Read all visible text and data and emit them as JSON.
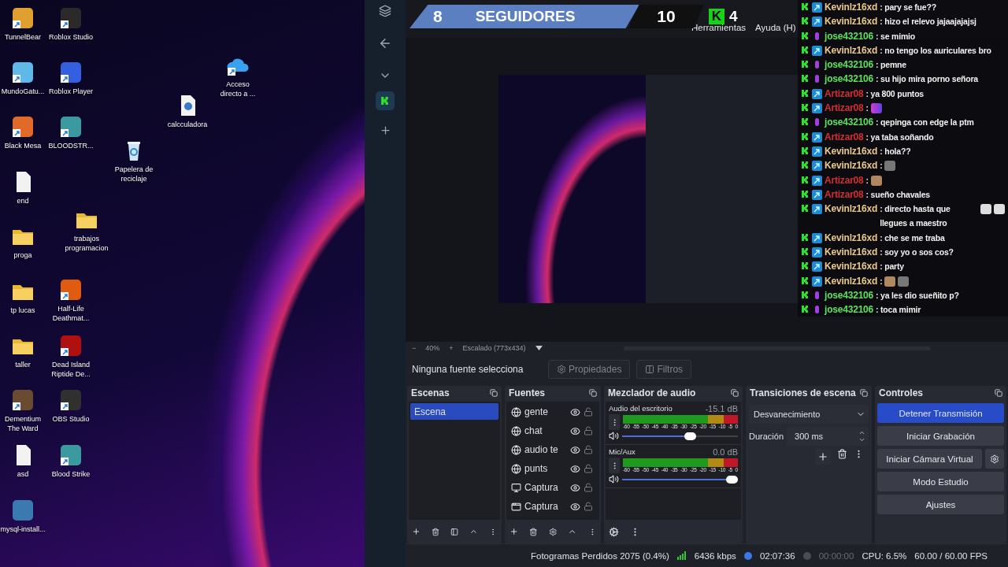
{
  "desktop": {
    "icons": [
      {
        "label": "TunnelBear",
        "kind": "app",
        "color": "#e0a030",
        "shortcut": true
      },
      {
        "label": "Roblox Studio",
        "kind": "app",
        "color": "#2a2a2a",
        "shortcut": true
      },
      {
        "label": "MundoGatu...",
        "kind": "app",
        "color": "#5fb8e8",
        "shortcut": true
      },
      {
        "label": "Roblox Player",
        "kind": "app",
        "color": "#335fe0",
        "shortcut": true
      },
      {
        "label": "Acceso directo a ...",
        "kind": "cloud",
        "shortcut": true
      },
      {
        "label": "calcculadora",
        "kind": "script",
        "shortcut": false
      },
      {
        "label": "Black Mesa",
        "kind": "app",
        "color": "#e06a2a",
        "shortcut": true
      },
      {
        "label": "BLOODSTR...",
        "kind": "app",
        "color": "#3a9aa0",
        "shortcut": true
      },
      {
        "label": "Papelera de reciclaje",
        "kind": "bin",
        "shortcut": false
      },
      {
        "label": "end",
        "kind": "file",
        "shortcut": false
      },
      {
        "label": "trabajos programacion",
        "kind": "folder",
        "shortcut": false
      },
      {
        "label": "proga",
        "kind": "folder",
        "shortcut": false
      },
      {
        "label": "tp lucas",
        "kind": "folder",
        "shortcut": false
      },
      {
        "label": "Half-Life Deathmat...",
        "kind": "app",
        "color": "#e05a10",
        "shortcut": true
      },
      {
        "label": "taller",
        "kind": "folder",
        "shortcut": false
      },
      {
        "label": "Dead Island Riptide De...",
        "kind": "app",
        "color": "#b01010",
        "shortcut": true
      },
      {
        "label": "Dementium The Ward",
        "kind": "app",
        "color": "#6a4a30",
        "shortcut": true
      },
      {
        "label": "OBS Studio",
        "kind": "app",
        "color": "#303030",
        "shortcut": true
      },
      {
        "label": "asd",
        "kind": "file",
        "shortcut": false
      },
      {
        "label": "Blood Strike",
        "kind": "app",
        "color": "#3a9aa0",
        "shortcut": true
      },
      {
        "label": "mysql-install...",
        "kind": "app",
        "color": "#3a7ab0",
        "shortcut": false
      }
    ]
  },
  "banner": {
    "followers": "8",
    "label": "SEGUIDORES",
    "goal": "10",
    "logo": "K",
    "viewers": "4"
  },
  "chat": [
    {
      "user": "Kevinlz16xd",
      "kind": "box",
      "color": "#e8c88a",
      "text": ": pary se fue??"
    },
    {
      "user": "Kevinlz16xd",
      "kind": "box",
      "color": "#e8c88a",
      "text": ": hizo el relevo jajaajajajsj"
    },
    {
      "user": "jose432106",
      "kind": "mic",
      "color": "#5ee05e",
      "text": ": se mimio"
    },
    {
      "user": "Kevinlz16xd",
      "kind": "box",
      "color": "#e8c88a",
      "text": ": no tengo los auriculares bro"
    },
    {
      "user": "jose432106",
      "kind": "mic",
      "color": "#5ee05e",
      "text": ": pemne"
    },
    {
      "user": "jose432106",
      "kind": "mic",
      "color": "#5ee05e",
      "text": ": su hijo mira porno señora"
    },
    {
      "user": "Artizar08",
      "kind": "box",
      "color": "#d03030",
      "text": ": ya 800 puntos"
    },
    {
      "user": "Artizar08",
      "kind": "box",
      "color": "#d03030",
      "text": ":",
      "emotes": [
        {
          "kind": "bars"
        }
      ]
    },
    {
      "user": "jose432106",
      "kind": "mic",
      "color": "#5ee05e",
      "text": ": qepinga con edge la ptm"
    },
    {
      "user": "Artizar08",
      "kind": "box",
      "color": "#d03030",
      "text": ": ya taba soñando"
    },
    {
      "user": "Kevinlz16xd",
      "kind": "box",
      "color": "#e8c88a",
      "text": ": hola??"
    },
    {
      "user": "Kevinlz16xd",
      "kind": "box",
      "color": "#e8c88a",
      "text": ":",
      "emotes": [
        {
          "kind": "rock"
        }
      ]
    },
    {
      "user": "Artizar08",
      "kind": "box",
      "color": "#d03030",
      "text": ":",
      "emotes": [
        {
          "kind": "cat"
        }
      ]
    },
    {
      "user": "Artizar08",
      "kind": "box",
      "color": "#d03030",
      "text": ": sueño chavales"
    },
    {
      "user": "Kevinlz16xd",
      "kind": "box",
      "color": "#e8c88a",
      "text": ": directo hasta que llegues a maestro",
      "emotes": [
        {
          "kind": "puff"
        },
        {
          "kind": "puff"
        }
      ]
    },
    {
      "user": "Kevinlz16xd",
      "kind": "box",
      "color": "#e8c88a",
      "text": ": che se me traba"
    },
    {
      "user": "Kevinlz16xd",
      "kind": "box",
      "color": "#e8c88a",
      "text": ": soy yo o sos cos?"
    },
    {
      "user": "Kevinlz16xd",
      "kind": "box",
      "color": "#e8c88a",
      "text": ": party"
    },
    {
      "user": "Kevinlz16xd",
      "kind": "box",
      "color": "#e8c88a",
      "text": ":",
      "emotes": [
        {
          "kind": "cat"
        },
        {
          "kind": "rock"
        }
      ]
    },
    {
      "user": "jose432106",
      "kind": "mic",
      "color": "#5ee05e",
      "text": ": ya les dio sueñito p?"
    },
    {
      "user": "jose432106",
      "kind": "mic",
      "color": "#5ee05e",
      "text": ": toca mimir"
    }
  ],
  "obs": {
    "menu": [
      "Herramientas",
      "Ayuda (H)"
    ],
    "zoom_bar": {
      "minus": "−",
      "zoom": "40%",
      "plus": "+",
      "scale": "Escalado (773x434)"
    },
    "source_bar": {
      "status": "Ninguna fuente selecciona",
      "properties": "Propiedades",
      "filters": "Filtros"
    },
    "scenes": {
      "title": "Escenas",
      "items": [
        {
          "name": "Escena",
          "selected": true
        }
      ]
    },
    "sources": {
      "title": "Fuentes",
      "items": [
        {
          "name": "gente",
          "kind": "browser",
          "visible": true,
          "locked": false
        },
        {
          "name": "chat",
          "kind": "browser",
          "visible": true,
          "locked": false
        },
        {
          "name": "audio te",
          "kind": "browser",
          "visible": true,
          "locked": false
        },
        {
          "name": "punts",
          "kind": "browser",
          "visible": true,
          "locked": false
        },
        {
          "name": "Captura",
          "kind": "display",
          "visible": true,
          "locked": false
        },
        {
          "name": "Captura",
          "kind": "window",
          "visible": true,
          "locked": false
        }
      ]
    },
    "mixer": {
      "title": "Mezclador de audio",
      "channels": [
        {
          "name": "Audio del escritorio",
          "reading": "-15.1 dB",
          "meter": {
            "level": 1
          },
          "volume": {
            "level": 0.6
          },
          "scale": [
            "-60",
            "-55",
            "-50",
            "-45",
            "-40",
            "-35",
            "-30",
            "-25",
            "-20",
            "-15",
            "-10",
            "-5",
            "0"
          ]
        },
        {
          "name": "Mic/Aux",
          "reading": "0.0 dB",
          "meter": {
            "level": 1
          },
          "volume": {
            "level": 1
          },
          "scale": [
            "-60",
            "-55",
            "-50",
            "-45",
            "-40",
            "-35",
            "-30",
            "-25",
            "-20",
            "-15",
            "-10",
            "-5",
            "0"
          ]
        }
      ]
    },
    "transitions": {
      "title": "Transiciones de escena",
      "transition": "Desvanecimiento",
      "duration_label": "Duración",
      "duration": "300 ms"
    },
    "controls": {
      "title": "Controles",
      "buttons": [
        {
          "label": "Detener Transmisión",
          "active": true,
          "settings": false
        },
        {
          "label": "Iniciar Grabación",
          "active": false,
          "settings": false
        },
        {
          "label": "Iniciar Cámara Virtual",
          "active": false,
          "settings": true
        },
        {
          "label": "Modo Estudio",
          "active": false,
          "settings": false
        },
        {
          "label": "Ajustes",
          "active": false,
          "settings": false
        }
      ]
    },
    "status_bar": {
      "dropped": "Fotogramas Perdidos 2075 (0.4%)",
      "bitrate": "6436 kbps",
      "live_time": "02:07:36",
      "live": true,
      "rec_time": "00:00:00",
      "recording": false,
      "cpu": "CPU: 6.5%",
      "fps": "60.00 / 60.00 FPS"
    }
  }
}
